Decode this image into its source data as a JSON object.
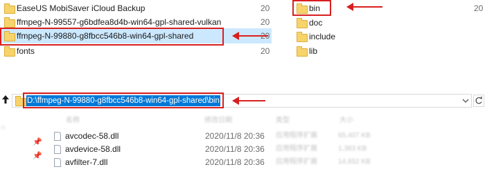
{
  "left_folder_list": {
    "items": [
      {
        "name": "EaseUS MobiSaver iCloud Backup",
        "num": "20"
      },
      {
        "name": "ffmpeg-N-99557-g6bdfea8d4b-win64-gpl-shared-vulkan",
        "num": "20"
      },
      {
        "name": "ffmpeg-N-99880-g8fbcc546b8-win64-gpl-shared",
        "num": "20"
      },
      {
        "name": "fonts",
        "num": "20"
      }
    ]
  },
  "right_folder_list": {
    "items": [
      {
        "name": "bin",
        "num": "20"
      },
      {
        "name": "doc",
        "num": ""
      },
      {
        "name": "include",
        "num": ""
      },
      {
        "name": "lib",
        "num": ""
      }
    ]
  },
  "address_bar": {
    "path": "D:\\ffmpeg-N-99880-g8fbcc546b8-win64-gpl-shared\\bin",
    "up_icon": "up-arrow-icon",
    "dropdown_icon": "chevron-down-icon",
    "refresh_icon": "refresh-icon"
  },
  "file_list": {
    "headers": [
      "名称",
      "修改日期",
      "类型",
      "大小"
    ],
    "rows": [
      {
        "name": "avcodec-58.dll",
        "date": "2020/11/8 20:36",
        "type": "应用程序扩展",
        "size": "65,407 KB"
      },
      {
        "name": "avdevice-58.dll",
        "date": "2020/11/8 20:36",
        "type": "应用程序扩展",
        "size": "1,383 KB"
      },
      {
        "name": "avfilter-7.dll",
        "date": "2020/11/8 20:36",
        "type": "应用程序扩展",
        "size": "14,652 KB"
      }
    ]
  },
  "annotation_color": "#d81e1e"
}
